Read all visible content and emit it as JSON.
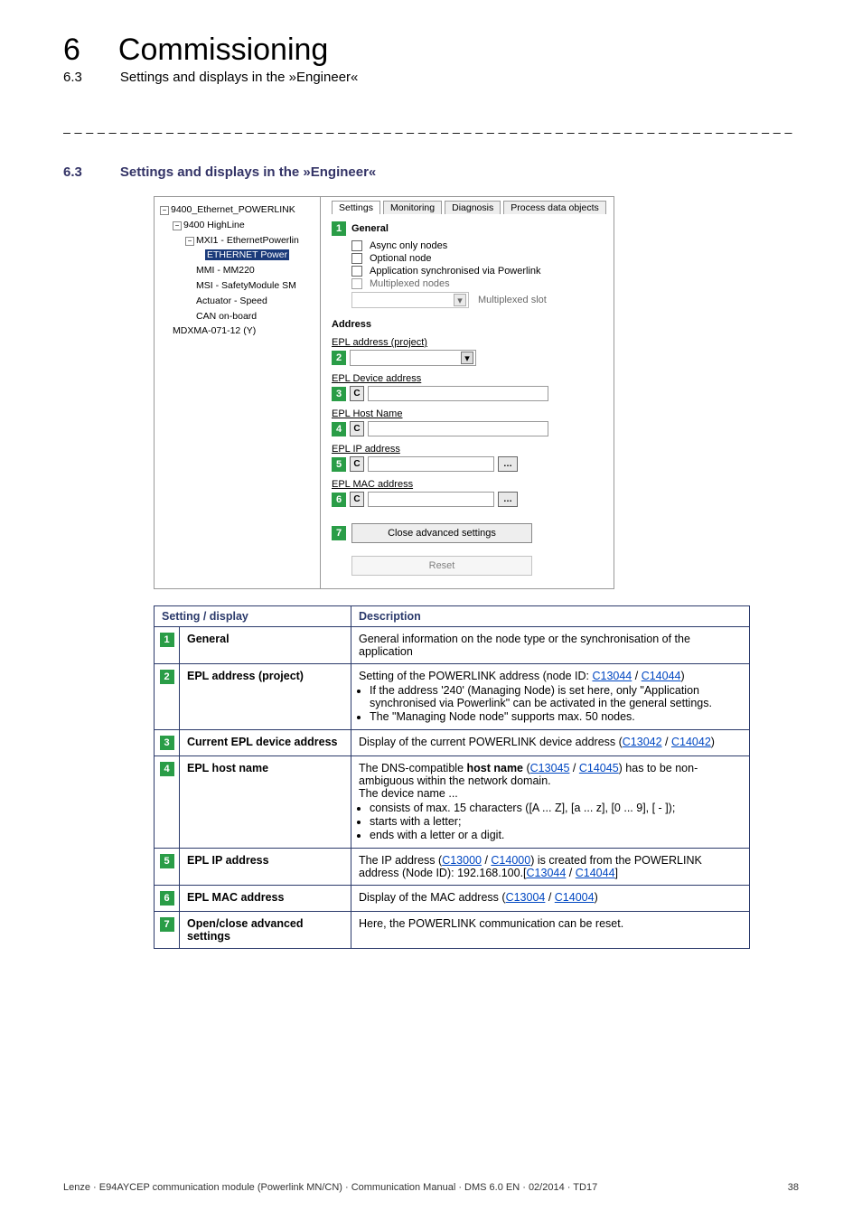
{
  "header": {
    "chapter_num": "6",
    "chapter_title": "Commissioning",
    "sub_num": "6.3",
    "sub_title": "Settings and displays in the »Engineer«"
  },
  "dash_rule": "_ _ _ _ _ _ _ _ _ _ _ _ _ _ _ _ _ _ _ _ _ _ _ _ _ _ _ _ _ _ _ _ _ _ _ _ _ _ _ _ _ _ _ _ _ _ _ _ _ _ _ _ _ _ _ _ _ _ _ _ _ _ _ _",
  "section": {
    "num": "6.3",
    "title": "Settings and displays in the »Engineer«"
  },
  "tree": {
    "n0": "9400_Ethernet_POWERLINK",
    "n1": "9400 HighLine",
    "n2": "MXI1 - EthernetPowerlin",
    "n3": "ETHERNET Power",
    "n4": "MMI - MM220",
    "n5": "MSI - SafetyModule SM",
    "n6": "Actuator - Speed",
    "n7": "CAN on-board",
    "n8": "MDXMA-071-12 (Y)"
  },
  "tabs": {
    "t1": "Settings",
    "t2": "Monitoring",
    "t3": "Diagnosis",
    "t4": "Process data objects"
  },
  "panel": {
    "general": "General",
    "async": "Async only nodes",
    "optional": "Optional node",
    "app_sync": "Application synchronised via Powerlink",
    "multi_nodes": "Multiplexed nodes",
    "multi_slot": "Multiplexed slot",
    "address_head": "Address",
    "epl_project": "EPL address (project)",
    "epl_device": "EPL Device address",
    "epl_host": "EPL Host Name",
    "epl_ip": "EPL IP address",
    "epl_mac": "EPL MAC address",
    "close_adv": "Close advanced settings",
    "reset": "Reset"
  },
  "c_label": "C",
  "badges": {
    "b1": "1",
    "b2": "2",
    "b3": "3",
    "b4": "4",
    "b5": "5",
    "b6": "6",
    "b7": "7"
  },
  "table": {
    "h1": "Setting / display",
    "h2": "Description",
    "r1": {
      "label": "General",
      "desc": "General information on the node type or the synchronisation of the application"
    },
    "r2": {
      "label": "EPL address (project)",
      "lead": "Setting of the POWERLINK address (node ID: ",
      "link1": "C13044",
      "sep": " / ",
      "link2": "C14044",
      "tail": ")",
      "li1": "If the address '240' (Managing Node) is set here, only \"Application synchronised via Powerlink\" can be activated in the general settings.",
      "li2": "The \"Managing Node node\" supports max. 50 nodes."
    },
    "r3": {
      "label": "Current EPL device address",
      "lead": "Display of the current POWERLINK device address (",
      "link1": "C13042",
      "sep": " / ",
      "link2": "C14042",
      "tail": ")"
    },
    "r4": {
      "label": "EPL host name",
      "p1a": "The DNS-compatible ",
      "p1b": "host name",
      "p1c": " (",
      "link1": "C13045",
      "sep": " / ",
      "link2": "C14045",
      "p1d": ") has to be non-ambiguous within the network domain.",
      "p2": "The device name ...",
      "li1": "consists of max. 15 characters ([A ... Z], [a ... z], [0 ... 9], [ - ]);",
      "li2": "starts with a letter;",
      "li3": "ends with a letter or a digit."
    },
    "r5": {
      "label": "EPL IP address",
      "lead": "The IP address (",
      "link1": "C13000",
      "sep": " / ",
      "link2": "C14000",
      "mid": ") is created from the POWERLINK address (Node ID): 192.168.100.[",
      "link3": "C13044",
      "sep2": " / ",
      "link4": "C14044",
      "tail": "]"
    },
    "r6": {
      "label": "EPL MAC address",
      "lead": "Display of the MAC address (",
      "link1": "C13004",
      "sep": " / ",
      "link2": "C14004",
      "tail": ")"
    },
    "r7": {
      "label": "Open/close advanced settings",
      "desc": "Here, the POWERLINK communication can be reset."
    }
  },
  "footer": {
    "left": "Lenze · E94AYCEP communication module (Powerlink MN/CN) · Communication Manual · DMS 6.0 EN · 02/2014 · TD17",
    "page": "38"
  }
}
